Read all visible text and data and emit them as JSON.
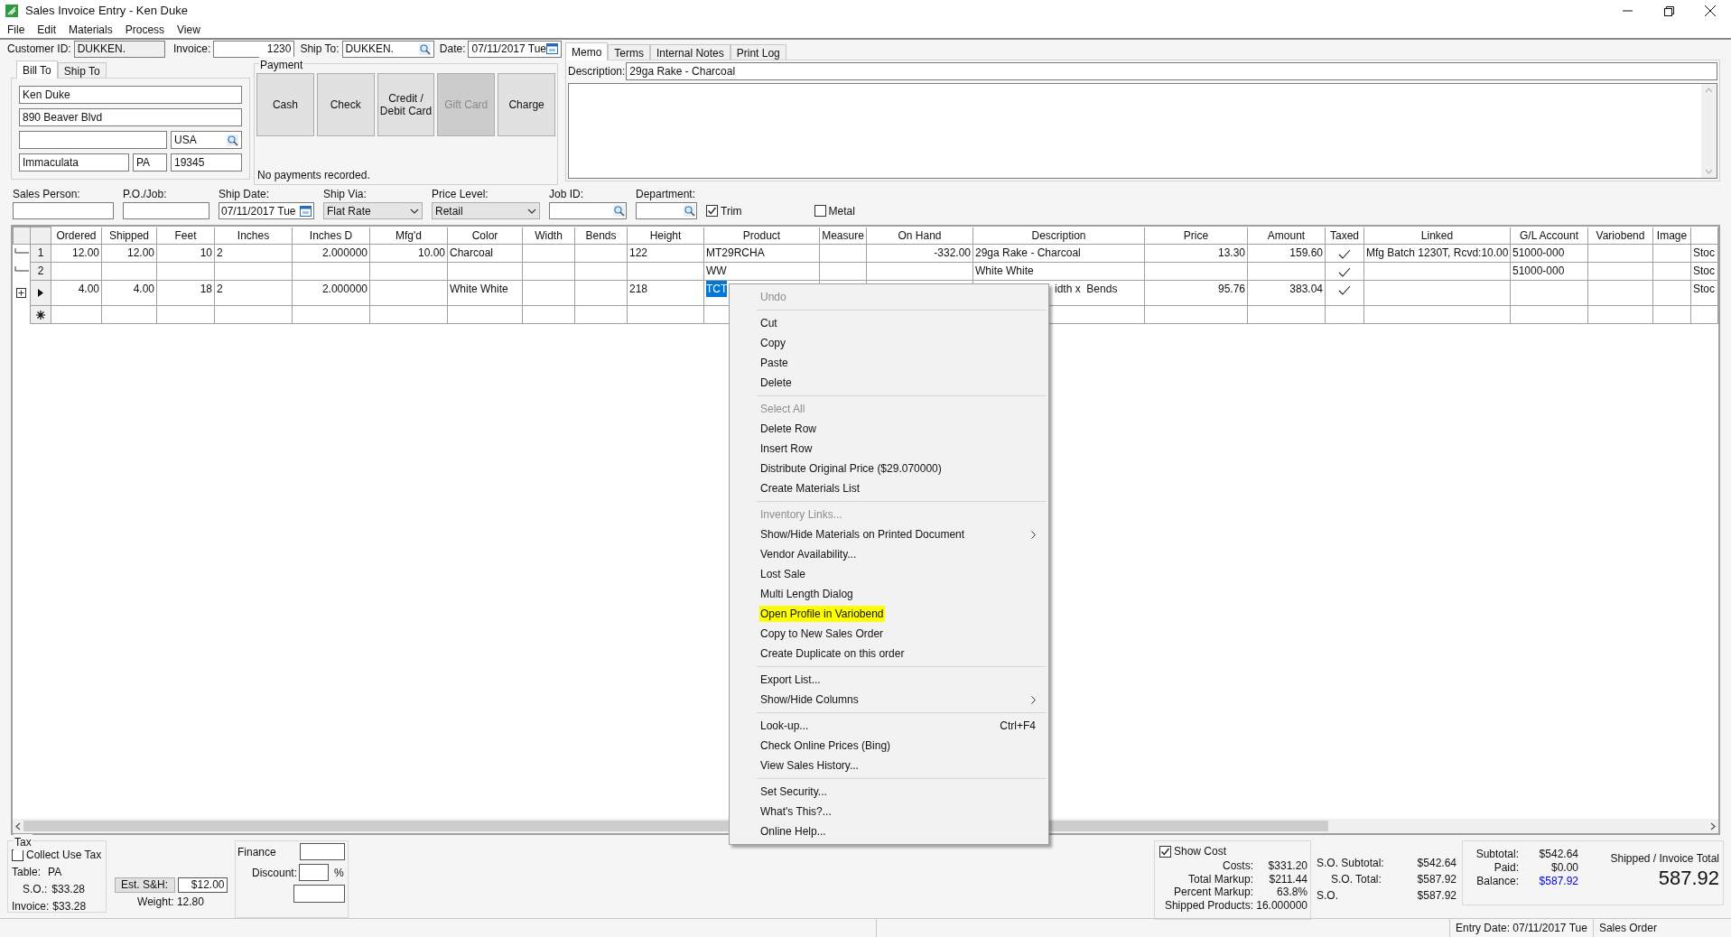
{
  "window": {
    "title": "Sales Invoice Entry - Ken Duke"
  },
  "menu_bar": [
    "File",
    "Edit",
    "Materials",
    "Process",
    "View"
  ],
  "header": {
    "customer_id_label": "Customer ID:",
    "customer_id": "DUKKEN.",
    "invoice_label": "Invoice:",
    "invoice": "1230",
    "ship_to_label": "Ship To:",
    "ship_to": "DUKKEN.",
    "date_label": "Date:",
    "date": "07/11/2017 Tue"
  },
  "address_tabs": [
    {
      "label": "Bill To",
      "selected": true
    },
    {
      "label": "Ship To",
      "selected": false
    }
  ],
  "address": {
    "name": "Ken Duke",
    "street": "890 Beaver Blvd",
    "country": "USA",
    "city": "Immaculata",
    "state": "PA",
    "zip": "19345"
  },
  "payment": {
    "title": "Payment",
    "status": "No payments recorded.",
    "buttons": [
      {
        "label": "Cash",
        "disabled": false
      },
      {
        "label": "Check",
        "disabled": false
      },
      {
        "label": "Credit /\nDebit Card",
        "disabled": false
      },
      {
        "label": "Gift Card",
        "disabled": true
      },
      {
        "label": "Charge",
        "disabled": false
      }
    ]
  },
  "memo_tabs": [
    {
      "label": "Memo",
      "selected": true
    },
    {
      "label": "Terms",
      "selected": false
    },
    {
      "label": "Internal Notes",
      "selected": false
    },
    {
      "label": "Print Log",
      "selected": false
    }
  ],
  "memo": {
    "description_label": "Description:",
    "description": "29ga Rake - Charcoal"
  },
  "order_fields": [
    {
      "label": "Sales Person:",
      "kind": "text"
    },
    {
      "label": "P.O./Job:",
      "kind": "text"
    },
    {
      "label": "Ship Date:",
      "kind": "date",
      "value": "07/11/2017 Tue"
    },
    {
      "label": "Ship Via:",
      "kind": "dropdown",
      "value": "Flat Rate"
    },
    {
      "label": "Price Level:",
      "kind": "dropdown",
      "value": "Retail"
    },
    {
      "label": "Job ID:",
      "kind": "lookup"
    },
    {
      "label": "Department:",
      "kind": "lookup"
    }
  ],
  "order_options": [
    {
      "label": "Trim",
      "checked": true
    },
    {
      "label": "Metal",
      "checked": false
    }
  ],
  "grid": {
    "columns": [
      {
        "label": "Ordered",
        "kind": "number"
      },
      {
        "label": "Shipped",
        "kind": "number"
      },
      {
        "label": "Feet",
        "kind": "number"
      },
      {
        "label": "Inches",
        "kind": "text"
      },
      {
        "label": "Inches D",
        "kind": "number"
      },
      {
        "label": "Mfg'd",
        "kind": "number"
      },
      {
        "label": "Color",
        "kind": "text"
      },
      {
        "label": "Width",
        "kind": "text"
      },
      {
        "label": "Bends",
        "kind": "text"
      },
      {
        "label": "Height",
        "kind": "text"
      },
      {
        "label": "Product",
        "kind": "text"
      },
      {
        "label": "Measure",
        "kind": "text"
      },
      {
        "label": "On Hand",
        "kind": "number"
      },
      {
        "label": "Description",
        "kind": "text"
      },
      {
        "label": "Price",
        "kind": "number"
      },
      {
        "label": "Amount",
        "kind": "number"
      },
      {
        "label": "Taxed",
        "kind": "check"
      },
      {
        "label": "Linked",
        "kind": "text"
      },
      {
        "label": "G/L Account",
        "kind": "text"
      },
      {
        "label": "Variobend",
        "kind": "text"
      },
      {
        "label": "Image",
        "kind": "text"
      },
      {
        "kind": "text"
      }
    ],
    "rows": [
      {
        "kind": "numbered",
        "label": "1",
        "cells": [
          {
            "text": "12.00"
          },
          {
            "text": "12.00"
          },
          {
            "text": "10"
          },
          {
            "text": "2"
          },
          {
            "text": "2.000000"
          },
          {
            "text": "10.00"
          },
          {
            "text": "Charcoal"
          },
          {},
          {},
          {
            "text": "122"
          },
          {
            "text": "MT29RCHA"
          },
          {},
          {
            "text": "-332.00"
          },
          {
            "text": "29ga Rake - Charcoal"
          },
          {
            "text": "13.30"
          },
          {
            "text": "159.60"
          },
          {
            "checked": true
          },
          {
            "text": "Mfg Batch 1230T, Rcvd:10.00"
          },
          {
            "text": "51000-000"
          },
          {},
          {},
          {
            "text": "Stoc"
          }
        ]
      },
      {
        "kind": "numbered",
        "label": "2",
        "cells": [
          {},
          {},
          {},
          {},
          {},
          {},
          {},
          {},
          {},
          {},
          {
            "text": "WW"
          },
          {},
          {},
          {
            "text": "White White"
          },
          {},
          {},
          {
            "checked": true
          },
          {},
          {
            "text": "51000-000"
          },
          {},
          {},
          {
            "text": "Stoc"
          }
        ]
      },
      {
        "kind": "current",
        "cells": [
          {
            "text": "4.00"
          },
          {
            "text": "4.00"
          },
          {
            "text": "18"
          },
          {
            "text": "2"
          },
          {
            "text": "2.000000"
          },
          {},
          {
            "text": "White White"
          },
          {},
          {},
          {
            "text": "218"
          },
          {
            "text": "TCT",
            "selected": true
          },
          {},
          {},
          {
            "text": "idth x  Bends",
            "covered": true
          },
          {
            "text": "95.76"
          },
          {
            "text": "383.04"
          },
          {
            "checked": true
          },
          {},
          {},
          {},
          {},
          {
            "text": "Stoc"
          }
        ]
      },
      {
        "kind": "new",
        "cells": []
      }
    ]
  },
  "context_menu": [
    {
      "kind": "item",
      "label": "Undo",
      "disabled": true
    },
    {
      "kind": "separator"
    },
    {
      "kind": "item",
      "label": "Cut",
      "disabled": false
    },
    {
      "kind": "item",
      "label": "Copy",
      "disabled": false
    },
    {
      "kind": "item",
      "label": "Paste",
      "disabled": false
    },
    {
      "kind": "item",
      "label": "Delete",
      "disabled": false
    },
    {
      "kind": "separator"
    },
    {
      "kind": "item",
      "label": "Select All",
      "disabled": true
    },
    {
      "kind": "item",
      "label": "Delete Row",
      "disabled": false
    },
    {
      "kind": "item",
      "label": "Insert Row",
      "disabled": false
    },
    {
      "kind": "item",
      "label": "Distribute Original Price ($29.070000)",
      "disabled": false
    },
    {
      "kind": "item",
      "label": "Create Materials List",
      "disabled": false
    },
    {
      "kind": "separator"
    },
    {
      "kind": "item",
      "label": "Inventory Links...",
      "disabled": true
    },
    {
      "kind": "submenu",
      "label": "Show/Hide Materials on Printed Document",
      "disabled": false
    },
    {
      "kind": "item",
      "label": "Vendor Availability...",
      "disabled": false
    },
    {
      "kind": "item",
      "label": "Lost Sale",
      "disabled": false
    },
    {
      "kind": "item",
      "label": "Multi Length Dialog",
      "disabled": false
    },
    {
      "kind": "item",
      "label": "Open Profile in Variobend",
      "disabled": false,
      "highlighted": true
    },
    {
      "kind": "item",
      "label": "Copy to New Sales Order",
      "disabled": false
    },
    {
      "kind": "item",
      "label": "Create Duplicate on this order",
      "disabled": false
    },
    {
      "kind": "separator"
    },
    {
      "kind": "item",
      "label": "Export List...",
      "disabled": false
    },
    {
      "kind": "submenu",
      "label": "Show/Hide Columns",
      "disabled": false
    },
    {
      "kind": "separator"
    },
    {
      "kind": "item",
      "label": "Look-up...",
      "disabled": false,
      "shortcut": "Ctrl+F4"
    },
    {
      "kind": "item",
      "label": "Check Online Prices (Bing)",
      "disabled": false
    },
    {
      "kind": "item",
      "label": "View Sales History...",
      "disabled": false
    },
    {
      "kind": "separator"
    },
    {
      "kind": "item",
      "label": "Set Security...",
      "disabled": false
    },
    {
      "kind": "item",
      "label": "What's This?...",
      "disabled": false
    },
    {
      "kind": "item",
      "label": "Online Help...",
      "disabled": false
    }
  ],
  "tax": {
    "title": "Tax",
    "collect_use_tax": {
      "label": "Collect Use Tax",
      "checked": false
    },
    "table_label": "Table:",
    "table": "PA",
    "so_label": "S.O.:",
    "so": "$33.28",
    "invoice_label": "Invoice:",
    "invoice": "$33.28"
  },
  "shipping": {
    "button": "Est. S&H:",
    "value": "$12.00",
    "weight": "Weight: 12.80"
  },
  "finance": {
    "finance_label": "Finance",
    "discount_label": "Discount:",
    "percent": "%"
  },
  "cost": {
    "show_cost": {
      "label": "Show Cost",
      "checked": true
    },
    "rows": [
      {
        "label": "Costs:",
        "value": "$331.20"
      },
      {
        "label": "Total Markup:",
        "value": "$211.44"
      },
      {
        "label": "Percent Markup:",
        "value": "63.8%"
      },
      {
        "label": "Shipped Products:",
        "value": "16.000000"
      }
    ]
  },
  "so_totals": [
    {
      "label": "S.O. Subtotal:",
      "value": "$542.64"
    },
    {
      "label": "S.O. Total:",
      "value": "$587.92"
    },
    {
      "label": "S.O.",
      "value": "$587.92"
    }
  ],
  "totals": [
    {
      "label": "Subtotal:",
      "value": "$542.64",
      "kind": "plain"
    },
    {
      "label": "Paid:",
      "value": "$0.00",
      "kind": "plain"
    },
    {
      "label": "Balance:",
      "value": "$587.92",
      "kind": "link"
    }
  ],
  "invoice_total": {
    "label": "Shipped / Invoice Total",
    "value": "587.92"
  },
  "status_bar": [
    "Entry Date: 07/11/2017 Tue",
    "Sales Order"
  ]
}
